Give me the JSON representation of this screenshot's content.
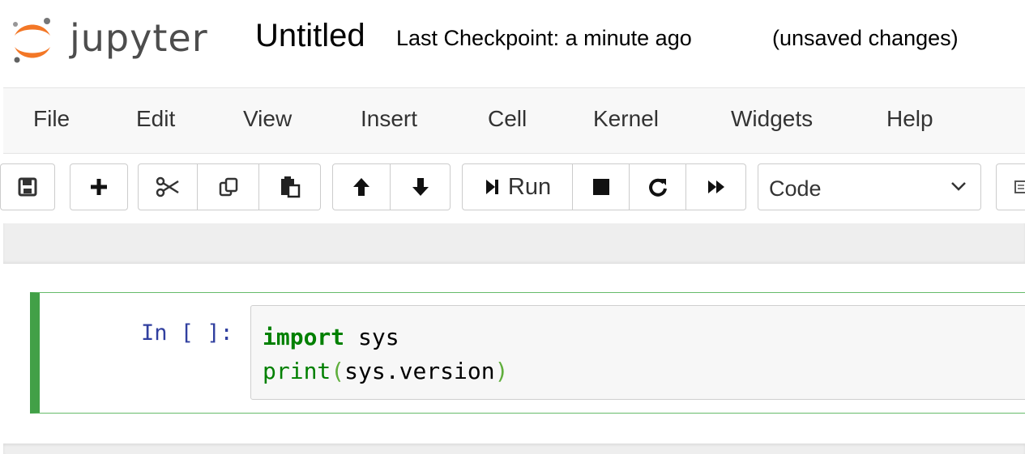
{
  "header": {
    "logo_text": "jupyter",
    "notebook_name": "Untitled",
    "checkpoint": "Last Checkpoint: a minute ago",
    "status": "(unsaved changes)"
  },
  "menubar": {
    "items": [
      "File",
      "Edit",
      "View",
      "Insert",
      "Cell",
      "Kernel",
      "Widgets",
      "Help"
    ]
  },
  "toolbar": {
    "buttons": [
      {
        "name": "save-button",
        "icon": "floppy-disk-icon"
      },
      {
        "name": "insert-cell-button",
        "icon": "plus-icon"
      },
      {
        "name": "cut-button",
        "icon": "scissors-icon"
      },
      {
        "name": "copy-button",
        "icon": "copy-icon"
      },
      {
        "name": "paste-button",
        "icon": "paste-icon"
      },
      {
        "name": "move-up-button",
        "icon": "arrow-up-icon"
      },
      {
        "name": "move-down-button",
        "icon": "arrow-down-icon"
      },
      {
        "name": "run-button",
        "icon": "step-forward-icon"
      },
      {
        "name": "interrupt-button",
        "icon": "stop-icon"
      },
      {
        "name": "restart-button",
        "icon": "redo-icon"
      },
      {
        "name": "restart-run-all-button",
        "icon": "fast-forward-icon"
      }
    ],
    "run_label": "Run",
    "cell_type": "Code"
  },
  "cell": {
    "prompt": "In [ ]:",
    "code": {
      "line1_keyword": "import",
      "line1_rest": " sys",
      "line2_func": "print",
      "line2_open": "(",
      "line2_arg": "sys.version",
      "line2_close": ")"
    }
  },
  "colors": {
    "logo_orange": "#f37726",
    "logo_gray": "#767677",
    "cell_border_selected": "#42a047",
    "prompt_blue": "#303f9f",
    "keyword_green": "#008000"
  }
}
